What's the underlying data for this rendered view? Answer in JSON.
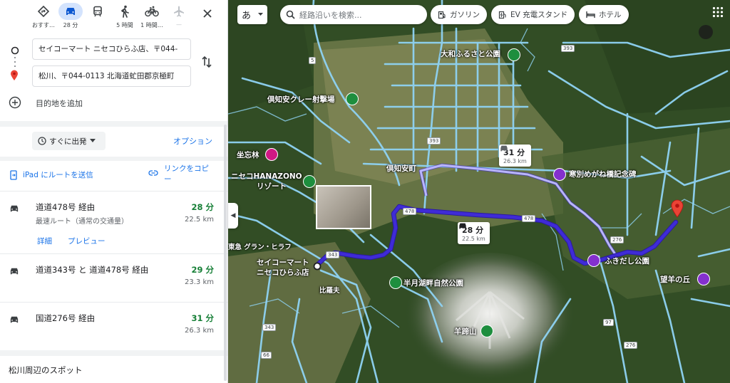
{
  "modes": [
    {
      "label": "おすす…",
      "icon": "recommended-icon"
    },
    {
      "label": "28 分",
      "icon": "car-icon"
    },
    {
      "label": "",
      "icon": "train-icon"
    },
    {
      "label": "5 時間",
      "icon": "walk-icon"
    },
    {
      "label": "1 時間…",
      "icon": "bike-icon"
    },
    {
      "label": "—",
      "icon": "plane-icon"
    }
  ],
  "origin": "セイコーマート ニセコひらふ店、〒044-",
  "destination": "松川、〒044-0113 北海道虻田郡京極町",
  "add_destination": "目的地を追加",
  "depart_label": "すぐに出発",
  "options_label": "オプション",
  "send_ipad": "iPad にルートを送信",
  "copy_link": "リンクをコピー",
  "routes": [
    {
      "name": "道道478号 経由",
      "sub": "最速ルート（通常の交通量）",
      "duration": "28 分",
      "distance": "22.5 km",
      "details": "詳細",
      "preview": "プレビュー"
    },
    {
      "name": "道道343号 と 道道478号 経由",
      "duration": "29 分",
      "distance": "23.3 km"
    },
    {
      "name": "国道276号 経由",
      "duration": "31 分",
      "distance": "26.3 km"
    }
  ],
  "nearby": "松川周辺のスポット",
  "map": {
    "ime": "あ",
    "search_placeholder": "経路沿いを検索...",
    "chips": [
      "ガソリン",
      "EV 充電スタンド",
      "ホテル"
    ],
    "labels": {
      "yamato": "大和ふるさと公園",
      "kutchan_clay": "倶知安クレー射撃場",
      "kutchan": "倶知安町",
      "zaboringen": "坐忘林",
      "hanazono": "ニセコHANAZONO",
      "resort": "リゾート",
      "tokyu": "東急 グラン・ヒラフ",
      "seicomart": "セイコーマート",
      "seicomart2": "ニセコひらふ店",
      "hirafu": "比羅夫",
      "hangetsu": "半月湖畔自然公園",
      "youtei": "羊蹄山",
      "kanbetsu": "寒別めがね橋記念碑",
      "fukidashi": "ふきだし公園",
      "bouyou": "望羊の丘"
    },
    "tooltips": [
      {
        "duration": "31 分",
        "distance": "26.3 km"
      },
      {
        "duration": "28 分",
        "distance": "22.5 km"
      }
    ],
    "road_numbers": [
      "393",
      "5",
      "478",
      "343",
      "276",
      "97",
      "66"
    ],
    "route_color": "#3f2bd6",
    "alt_route_color": "#a7a3f7"
  }
}
